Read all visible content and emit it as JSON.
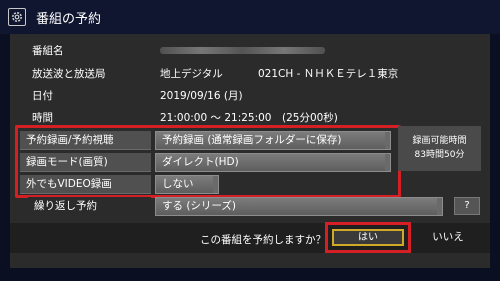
{
  "header": {
    "title": "番組の予約",
    "icon": "gear-icon"
  },
  "info": {
    "program_name_label": "番組名",
    "broadcast_label": "放送波と放送局",
    "broadcast_wave": "地上デジタル",
    "broadcast_channel": "021CH - ＮＨＫＥテレ１東京",
    "date_label": "日付",
    "date_value": "2019/09/16 (月)",
    "time_label": "時間",
    "time_value": "21:00:00 ～ 21:25:00　(25分00秒)"
  },
  "settings": {
    "reserve_type_label": "予約録画/予約視聴",
    "reserve_type_value": "予約録画 (通常録画フォルダーに保存)",
    "mode_label": "録画モード(画質)",
    "mode_value": "ダイレクト(HD)",
    "video_label": "外でもVIDEO録画",
    "video_value": "しない",
    "repeat_label": "繰り返し予約",
    "repeat_value": "する (シリーズ)",
    "help_label": "?"
  },
  "available": {
    "label": "録画可能時間",
    "value": "83時間50分"
  },
  "confirm": {
    "question": "この番組を予約しますか？",
    "yes": "はい",
    "no": "いいえ"
  },
  "colors": {
    "highlight": "#d41f25",
    "focus": "#d1a928",
    "background": "#0a0f22",
    "panel": "#2b2b2b"
  }
}
